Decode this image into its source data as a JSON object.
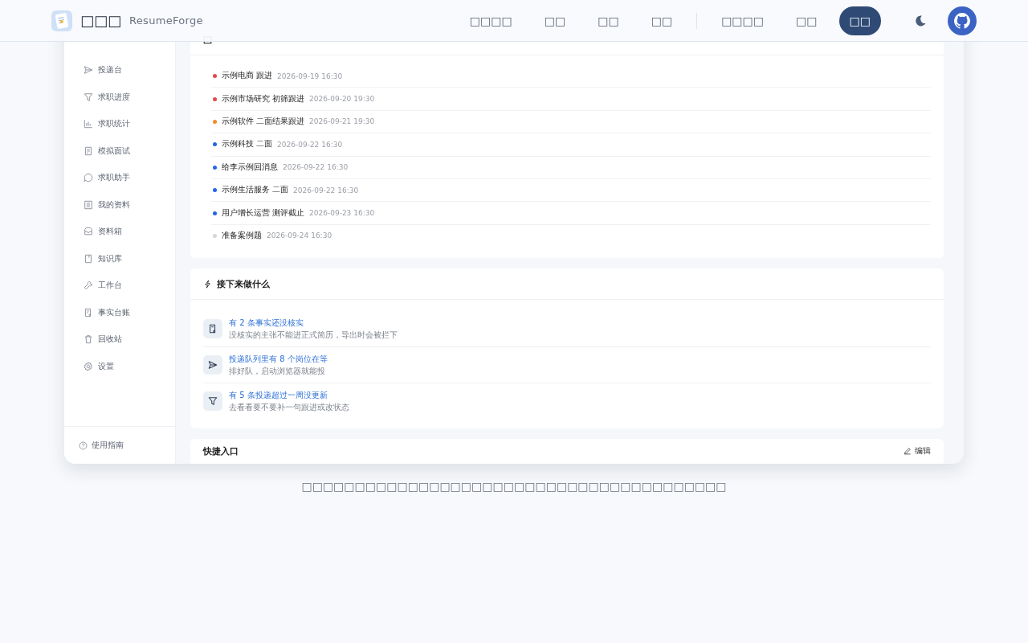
{
  "header": {
    "brand": "□□□",
    "brand_sub": "ResumeForge",
    "nav": [
      {
        "label": "□□□□",
        "selected": false
      },
      {
        "label": "□□",
        "selected": false
      },
      {
        "label": "□□",
        "selected": false
      },
      {
        "label": "□□",
        "selected": false
      },
      {
        "label": "□□□□",
        "selected": false,
        "group_start": true
      },
      {
        "label": "□□",
        "selected": false
      },
      {
        "label": "□□",
        "selected": true
      }
    ]
  },
  "sidebar": {
    "items": [
      "投递台",
      "求职进度",
      "求职统计",
      "模拟面试",
      "求职助手",
      "我的资料",
      "资料箱",
      "知识库",
      "工作台",
      "事实台账",
      "回收站",
      "设置"
    ],
    "footer": "使用指南"
  },
  "reminders": {
    "items": [
      {
        "text": "示例电商 跟进",
        "time": "2026-09-19 16:30",
        "color": "#e5484d"
      },
      {
        "text": "示例市场研究 初筛跟进",
        "time": "2026-09-20 19:30",
        "color": "#e5484d"
      },
      {
        "text": "示例软件 二面结果跟进",
        "time": "2026-09-21 19:30",
        "color": "#f08c2e"
      },
      {
        "text": "示例科技 二面",
        "time": "2026-09-22 16:30",
        "color": "#2563eb"
      },
      {
        "text": "给李示例回消息",
        "time": "2026-09-22 16:30",
        "color": "#2563eb"
      },
      {
        "text": "示例生活服务 二面",
        "time": "2026-09-22 16:30",
        "color": "#2563eb"
      },
      {
        "text": "用户增长运营 测评截止",
        "time": "2026-09-23 16:30",
        "color": "#2563eb"
      },
      {
        "text": "准备案例题",
        "time": "2026-09-24 16:30",
        "color": "#d4d6da"
      }
    ]
  },
  "next_steps": {
    "title": "接下来做什么",
    "items": [
      {
        "title": "有 2 条事实还没核实",
        "hint": "没核实的主张不能进正式简历，导出时会被拦下"
      },
      {
        "title": "投递队列里有 8 个岗位在等",
        "hint": "排好队，启动浏览器就能投"
      },
      {
        "title": "有 5 条投递超过一周没更新",
        "hint": "去看看要不要补一句跟进或改状态"
      }
    ]
  },
  "shortcuts": {
    "title": "快捷入口",
    "edit": "编辑"
  },
  "caption": "□□□□□□□□□□□□□□□□□□□□□□□□□□□□□□□□□□□□□□□□"
}
